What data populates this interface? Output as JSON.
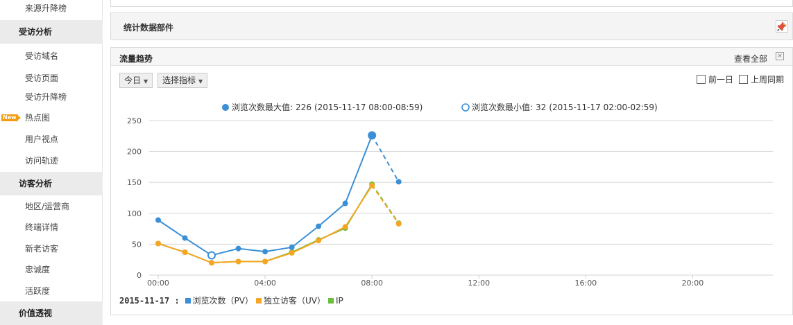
{
  "sidebar": {
    "items": [
      {
        "kind": "item",
        "label": "来源升降榜"
      },
      {
        "kind": "section",
        "label": "受访分析"
      },
      {
        "kind": "item",
        "label": "受访域名"
      },
      {
        "kind": "item",
        "label": "受访页面"
      },
      {
        "kind": "item",
        "label": "受访升降榜"
      },
      {
        "kind": "item",
        "label": "热点图",
        "badge": "New"
      },
      {
        "kind": "item",
        "label": "用户视点"
      },
      {
        "kind": "item",
        "label": "访问轨迹"
      },
      {
        "kind": "section",
        "label": "访客分析"
      },
      {
        "kind": "item",
        "label": "地区/运营商"
      },
      {
        "kind": "item",
        "label": "终端详情"
      },
      {
        "kind": "item",
        "label": "新老访客"
      },
      {
        "kind": "item",
        "label": "忠诚度"
      },
      {
        "kind": "item",
        "label": "活跃度"
      },
      {
        "kind": "section",
        "label": "价值透视"
      }
    ]
  },
  "stats_bar": {
    "title": "统计数据部件"
  },
  "panel": {
    "title": "流量趋势",
    "view_all": "查看全部",
    "close": "⊠",
    "day_select": "今日",
    "metric_select": "选择指标",
    "compare_prev_day": "前一日",
    "compare_last_week": "上周同期"
  },
  "annotations": {
    "max": {
      "label": "浏览次数最大值:",
      "value": "226",
      "range": "(2015-11-17 08:00-08:59)"
    },
    "min": {
      "label": "浏览次数最小值:",
      "value": "32",
      "range": "(2015-11-17 02:00-02:59)"
    }
  },
  "legend": {
    "date": "2015-11-17 :",
    "items": [
      {
        "label": "浏览次数（PV）",
        "color": "#3a8fd6"
      },
      {
        "label": "独立访客（UV）",
        "color": "#f5a623"
      },
      {
        "label": "IP",
        "color": "#6abf3a"
      }
    ]
  },
  "chart_data": {
    "type": "line",
    "x": [
      "00:00",
      "01:00",
      "02:00",
      "03:00",
      "04:00",
      "05:00",
      "06:00",
      "07:00",
      "08:00",
      "09:00"
    ],
    "x_tick_labels": [
      "00:00",
      "04:00",
      "08:00",
      "12:00",
      "16:00",
      "20:00"
    ],
    "x_tick_values": [
      0,
      4,
      8,
      12,
      16,
      20
    ],
    "xlim": [
      0,
      23
    ],
    "ylim": [
      0,
      250
    ],
    "y_ticks": [
      0,
      50,
      100,
      150,
      200,
      250
    ],
    "grid": true,
    "dashed_from_index": 8,
    "series": [
      {
        "name": "浏览次数（PV）",
        "color": "#3a8fd6",
        "values": [
          89,
          60,
          32,
          43,
          38,
          45,
          79,
          116,
          226,
          151
        ]
      },
      {
        "name": "独立访客（UV）",
        "color": "#f5a623",
        "values": [
          51,
          37,
          20,
          22,
          22,
          36,
          56,
          78,
          145,
          83
        ]
      },
      {
        "name": "IP",
        "color": "#6abf3a",
        "values": [
          51,
          37,
          20,
          22,
          22,
          37,
          57,
          76,
          147,
          84
        ]
      }
    ],
    "max_point": {
      "series": 0,
      "index": 8
    },
    "min_point": {
      "series": 0,
      "index": 2
    }
  }
}
